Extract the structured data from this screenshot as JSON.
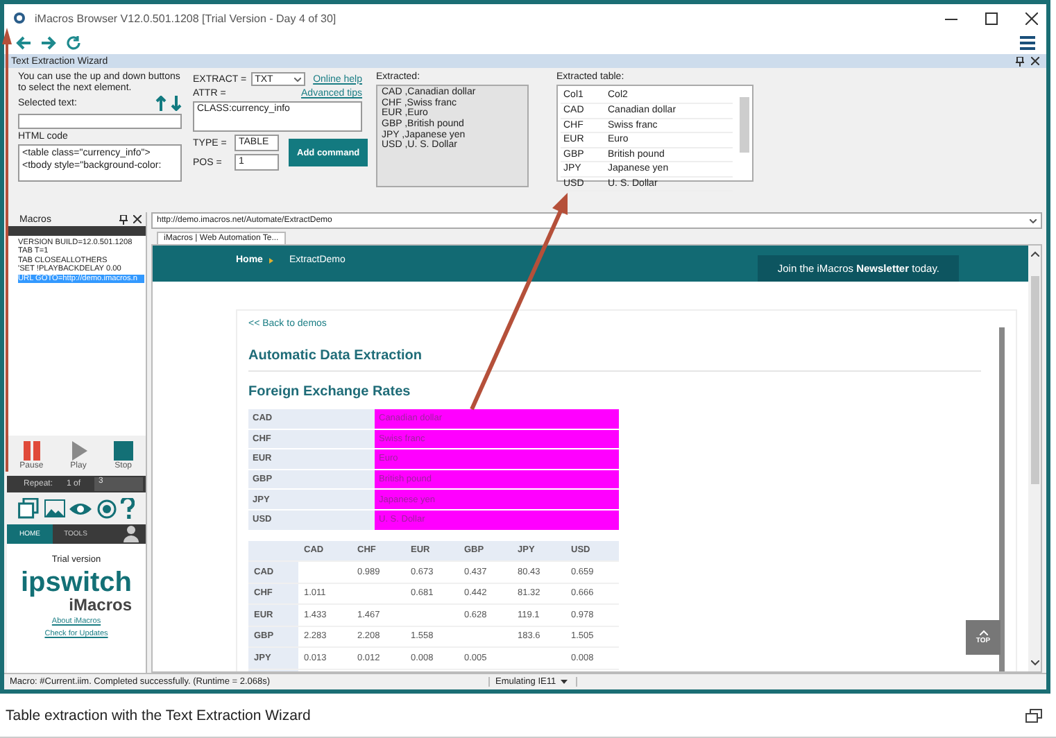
{
  "window": {
    "title": "iMacros Browser V12.0.501.1208 [Trial Version - Day 4 of 30]"
  },
  "wizard": {
    "title": "Text Extraction Wizard",
    "hint": "You can use the up and down buttons to select the next element.",
    "selected_text_label": "Selected text:",
    "html_code_label": "HTML code",
    "html_code": "<table class=\"currency_info\">    <tbody style=\"background-color:",
    "extract_label": "EXTRACT =",
    "extract_value": "TXT",
    "online_help": "Online help",
    "advanced_tips": "Advanced tips",
    "attr_label": "ATTR =",
    "attr_value": "CLASS:currency_info",
    "type_label": "TYPE =",
    "type_value": "TABLE",
    "pos_label": "POS =",
    "pos_value": "1",
    "add_button": "Add command",
    "extracted_label": "Extracted:",
    "extracted_lines": [
      "CAD ,Canadian dollar",
      "CHF ,Swiss franc",
      "EUR ,Euro",
      "GBP ,British pound",
      "JPY ,Japanese yen",
      "USD ,U. S. Dollar"
    ],
    "extracted_table_label": "Extracted table:",
    "extracted_table": {
      "columns": [
        "Col1",
        "Col2"
      ],
      "rows": [
        [
          "CAD",
          "Canadian dollar"
        ],
        [
          "CHF",
          "Swiss franc"
        ],
        [
          "EUR",
          "Euro"
        ],
        [
          "GBP",
          "British pound"
        ],
        [
          "JPY",
          "Japanese yen"
        ],
        [
          "USD",
          "U. S. Dollar"
        ]
      ]
    }
  },
  "macros": {
    "title": "Macros",
    "lines": [
      {
        "text": "VERSION BUILD=12.0.501.1208",
        "selected": false
      },
      {
        "text": "TAB T=1",
        "selected": false
      },
      {
        "text": "TAB CLOSEALLOTHERS",
        "selected": false
      },
      {
        "text": "'SET !PLAYBACKDELAY 0.00",
        "selected": false
      },
      {
        "text": "URL GOTO=http://demo.imacros.n",
        "selected": true
      }
    ],
    "controls": [
      {
        "label": "Pause",
        "kind": "pause"
      },
      {
        "label": "Play",
        "kind": "play"
      },
      {
        "label": "Stop",
        "kind": "stop"
      }
    ],
    "repeat_label": "Repeat:",
    "repeat_of": "1 of",
    "repeat_value": "3",
    "tabs": [
      {
        "label": "HOME",
        "selected": true
      },
      {
        "label": "TOOLS",
        "selected": false
      }
    ],
    "trial": "Trial version",
    "brand": "ipswitch",
    "product": "iMacros",
    "links": [
      "About iMacros",
      "Check for Updates"
    ]
  },
  "browser": {
    "url": "http://demo.imacros.net/Automate/ExtractDemo",
    "tab": "iMacros | Web Automation Te...",
    "breadcrumb": [
      "Home",
      "ExtractDemo"
    ],
    "newsletter": "Join the iMacros **Newsletter** today.",
    "back_link": "<< Back to demos",
    "heading": "Automatic Data Extraction",
    "subheading": "Foreign Exchange Rates",
    "currencies": [
      {
        "code": "CAD",
        "name": "Canadian dollar",
        "highlighted": true
      },
      {
        "code": "CHF",
        "name": "Swiss franc",
        "highlighted": true
      },
      {
        "code": "EUR",
        "name": "Euro",
        "highlighted": true
      },
      {
        "code": "GBP",
        "name": "British pound",
        "highlighted": true
      },
      {
        "code": "JPY",
        "name": "Japanese yen",
        "highlighted": true
      },
      {
        "code": "USD",
        "name": "U. S. Dollar",
        "highlighted": true
      }
    ],
    "rates": {
      "columns": [
        "CAD",
        "CHF",
        "EUR",
        "GBP",
        "JPY",
        "USD"
      ],
      "rows": [
        {
          "code": "CAD",
          "cells": [
            {
              "kind": "empty"
            },
            {
              "kind": "rate",
              "value": "0.989"
            },
            {
              "kind": "rate",
              "value": "0.673"
            },
            {
              "kind": "rate",
              "value": "0.437"
            },
            {
              "kind": "rate",
              "value": "80.43"
            },
            {
              "kind": "rate",
              "value": "0.659"
            }
          ]
        },
        {
          "code": "CHF",
          "cells": [
            {
              "kind": "rate",
              "value": "1.011"
            },
            {
              "kind": "empty"
            },
            {
              "kind": "rate",
              "value": "0.681"
            },
            {
              "kind": "rate",
              "value": "0.442"
            },
            {
              "kind": "rate",
              "value": "81.32"
            },
            {
              "kind": "rate",
              "value": "0.666"
            }
          ]
        },
        {
          "code": "EUR",
          "cells": [
            {
              "kind": "rate",
              "value": "1.433"
            },
            {
              "kind": "rate",
              "value": "1.467"
            },
            {
              "kind": "empty"
            },
            {
              "kind": "rate",
              "value": "0.628"
            },
            {
              "kind": "rate",
              "value": "119.1"
            },
            {
              "kind": "rate",
              "value": "0.978"
            }
          ]
        },
        {
          "code": "GBP",
          "cells": [
            {
              "kind": "rate",
              "value": "2.283"
            },
            {
              "kind": "rate",
              "value": "2.208"
            },
            {
              "kind": "rate",
              "value": "1.558"
            },
            {
              "kind": "empty"
            },
            {
              "kind": "rate",
              "value": "183.6"
            },
            {
              "kind": "rate",
              "value": "1.505"
            }
          ]
        },
        {
          "code": "JPY",
          "cells": [
            {
              "kind": "rate",
              "value": "0.013"
            },
            {
              "kind": "rate",
              "value": "0.012"
            },
            {
              "kind": "rate",
              "value": "0.008"
            },
            {
              "kind": "rate",
              "value": "0.005"
            },
            {
              "kind": "empty"
            },
            {
              "kind": "rate",
              "value": "0.008"
            }
          ]
        }
      ]
    },
    "top_button": "TOP"
  },
  "status_bar": {
    "message": "Macro: #Current.iim. Completed successfully. (Runtime = 2.068s)",
    "emulation": "Emulating IE11"
  },
  "caption": "Table extraction with the Text Extraction Wizard"
}
